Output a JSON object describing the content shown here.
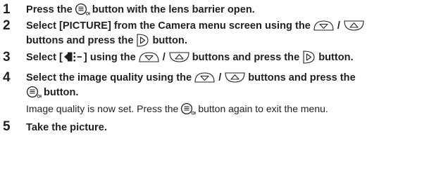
{
  "steps": [
    {
      "number": "1",
      "text_a": "Press the",
      "icon_a": "ok-button-icon",
      "text_b": "button with the lens barrier open."
    },
    {
      "number": "2",
      "text_a": "Select [PICTURE] from the Camera menu screen using the",
      "icon_a": "down-arrow-button-icon",
      "sep": "/",
      "icon_b": "up-arrow-button-icon",
      "text_c": "buttons and press the",
      "icon_c": "right-arrow-button-icon",
      "text_d": "button."
    },
    {
      "number": "3",
      "text_a": "Select [",
      "icon_a": "image-quality-icon",
      "text_b": "] using the",
      "icon_b": "down-arrow-button-icon",
      "sep": "/",
      "icon_c": "up-arrow-button-icon",
      "text_c": "buttons and press the",
      "icon_d": "right-arrow-button-icon",
      "text_d": "button."
    },
    {
      "number": "4",
      "text_a": "Select the image quality using the",
      "icon_a": "down-arrow-button-icon",
      "sep": "/",
      "icon_b": "up-arrow-button-icon",
      "text_b": "buttons and press the",
      "icon_c": "ok-button-icon",
      "text_c": "button.",
      "note_a": "Image quality is now set. Press the",
      "note_icon": "ok-button-icon",
      "note_b": "button again to exit the menu."
    },
    {
      "number": "5",
      "text_a": "Take the picture."
    }
  ],
  "colors": {
    "text": "#231f20"
  }
}
